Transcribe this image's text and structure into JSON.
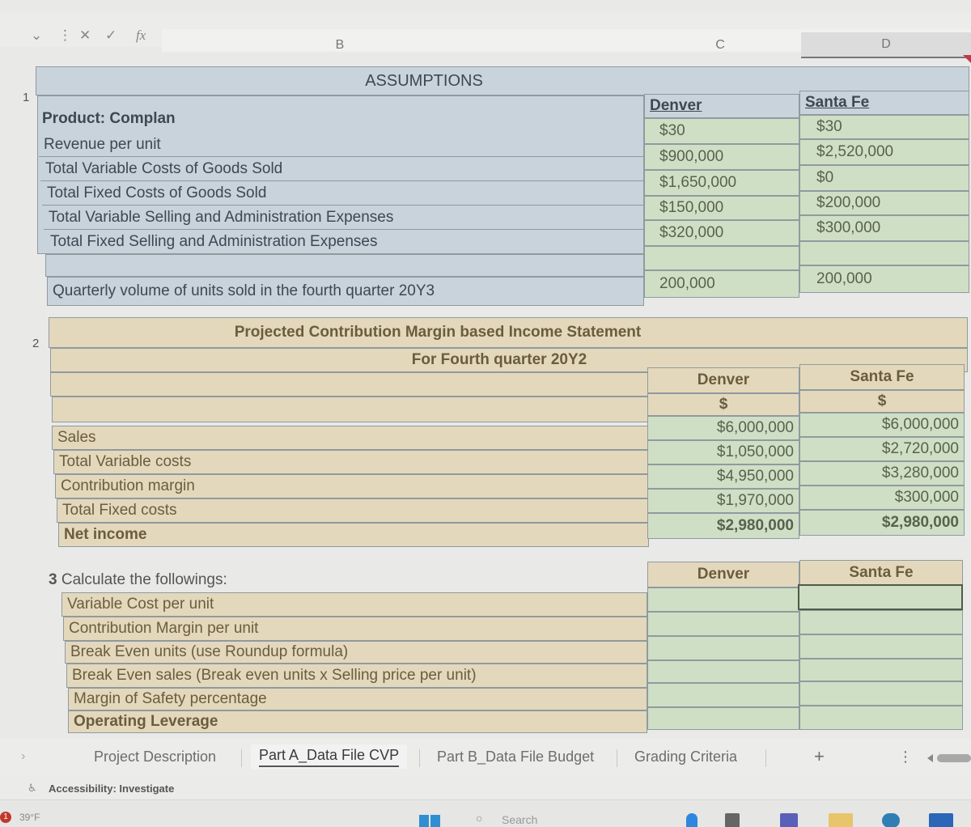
{
  "formula_bar": {
    "name_box_dropdown": "⌄",
    "more_icon": "⋮",
    "cancel_icon": "✕",
    "enter_icon": "✓",
    "fx_label": "fx",
    "formula_value": ""
  },
  "columns": {
    "b": "B",
    "c": "C",
    "d": "D"
  },
  "rows": {
    "r1": "1",
    "r2": "2",
    "r3": "3"
  },
  "assumptions": {
    "title": "ASSUMPTIONS",
    "header_denver": "Denver",
    "header_santafe": "Santa Fe",
    "items": [
      {
        "label": "Product: Complan",
        "denver": "",
        "santafe": ""
      },
      {
        "label": "Revenue per unit",
        "denver": "$30",
        "santafe": "$30"
      },
      {
        "label": "Total Variable Costs of Goods Sold",
        "denver": "$900,000",
        "santafe": "$2,520,000"
      },
      {
        "label": "Total Fixed Costs of Goods Sold",
        "denver": "$1,650,000",
        "santafe": "$0"
      },
      {
        "label": "Total Variable Selling and Administration Expenses",
        "denver": "$150,000",
        "santafe": "$200,000"
      },
      {
        "label": "Total Fixed Selling and Administration Expenses",
        "denver": "$320,000",
        "santafe": "$300,000"
      }
    ],
    "volume_label": "Quarterly volume of units sold in the fourth quarter 20Y3",
    "volume_denver": "200,000",
    "volume_santafe": "200,000"
  },
  "income_statement": {
    "title": "Projected Contribution Margin based Income Statement",
    "subtitle": "For Fourth quarter 20Y2",
    "header_denver": "Denver",
    "header_santafe": "Santa Fe",
    "currency_denver": "$",
    "currency_santafe": "$",
    "items": [
      {
        "label": "Sales",
        "denver": "$6,000,000",
        "santafe": "$6,000,000"
      },
      {
        "label": "Total Variable costs",
        "denver": "$1,050,000",
        "santafe": "$2,720,000"
      },
      {
        "label": "Contribution margin",
        "denver": "$4,950,000",
        "santafe": "$3,280,000"
      },
      {
        "label": "Total Fixed costs",
        "denver": "$1,970,000",
        "santafe": "$300,000"
      },
      {
        "label": "Net income",
        "denver": "$2,980,000",
        "santafe": "$2,980,000"
      }
    ]
  },
  "calculations": {
    "number": "3",
    "title": "Calculate the followings:",
    "header_denver": "Denver",
    "header_santafe": "Santa Fe",
    "items": [
      {
        "label": "Variable Cost per unit",
        "denver": "",
        "santafe": ""
      },
      {
        "label": "Contribution Margin per unit",
        "denver": "",
        "santafe": ""
      },
      {
        "label": "Break Even units (use Roundup formula)",
        "denver": "",
        "santafe": ""
      },
      {
        "label": "Break Even sales (Break even units x Selling price per unit)",
        "denver": "",
        "santafe": ""
      },
      {
        "label": "Margin of Safety percentage",
        "denver": "",
        "santafe": ""
      },
      {
        "label": "Operating Leverage",
        "denver": "",
        "santafe": ""
      }
    ]
  },
  "sheet_tabs": {
    "tabs": [
      "Project Description",
      "Part A_Data File CVP",
      "Part B_Data File Budget",
      "Grading Criteria"
    ],
    "active": "Part A_Data File CVP",
    "add_label": "+",
    "more_label": "⋮"
  },
  "status_bar": {
    "accessibility": "Accessibility: Investigate"
  },
  "taskbar": {
    "weather": "39°F",
    "notification_count": "1",
    "search_placeholder": "Search"
  },
  "colors": {
    "assumption_bg": "#c9d3dc",
    "value_green": "#cfdfc5",
    "statement_tan": "#e4d8bc"
  }
}
